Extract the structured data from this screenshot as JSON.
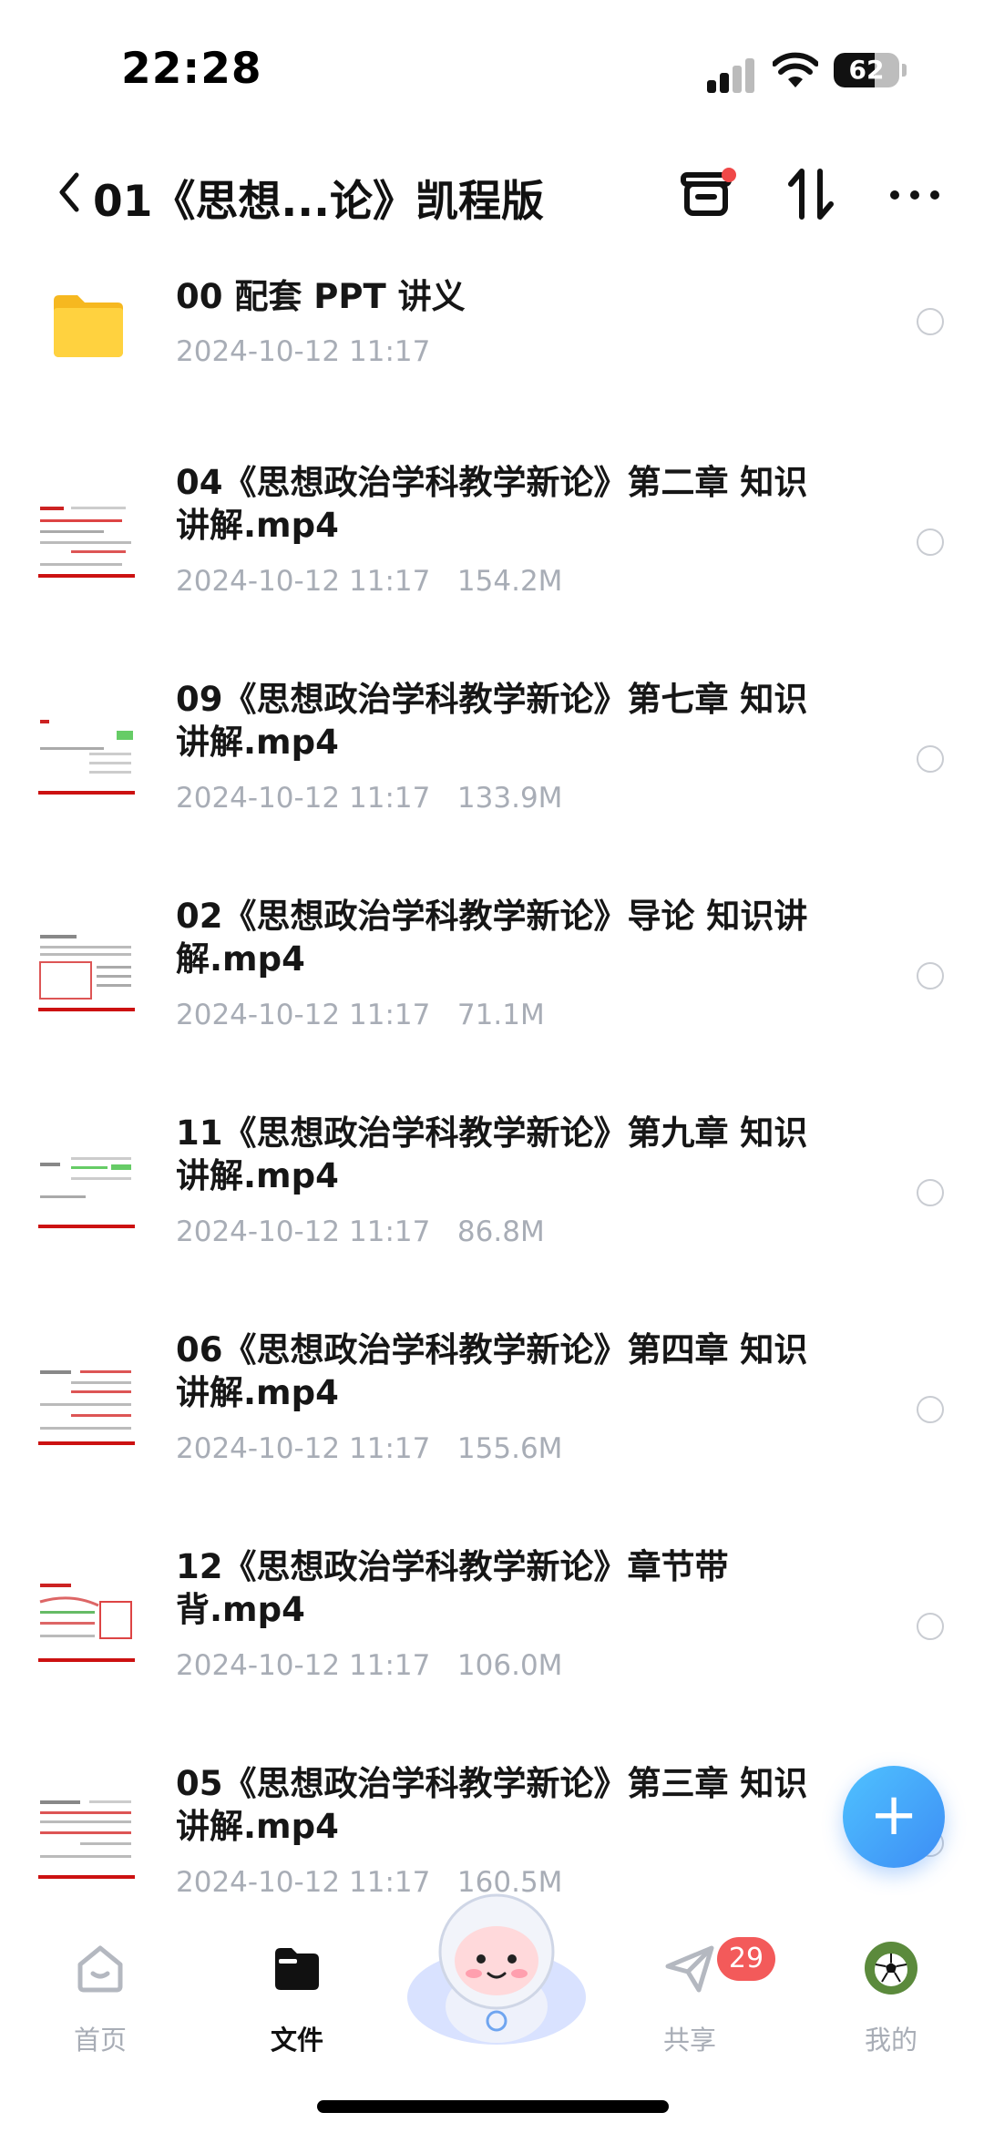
{
  "status_bar": {
    "time": "22:28",
    "battery": "62",
    "battery_level": 0.62
  },
  "nav": {
    "title": "01《思想...论》凯程版"
  },
  "files": [
    {
      "name": "00 配套 PPT 讲义",
      "date": "2024-10-12 11:17",
      "size": "",
      "type": "folder"
    },
    {
      "name": "04《思想政治学科教学新论》第二章 知识讲解.mp4",
      "date": "2024-10-12 11:17",
      "size": "154.2M",
      "type": "video"
    },
    {
      "name": "09《思想政治学科教学新论》第七章 知识讲解.mp4",
      "date": "2024-10-12 11:17",
      "size": "133.9M",
      "type": "video"
    },
    {
      "name": "02《思想政治学科教学新论》导论 知识讲解.mp4",
      "date": "2024-10-12 11:17",
      "size": "71.1M",
      "type": "video"
    },
    {
      "name": "11《思想政治学科教学新论》第九章 知识讲解.mp4",
      "date": "2024-10-12 11:17",
      "size": "86.8M",
      "type": "video"
    },
    {
      "name": "06《思想政治学科教学新论》第四章 知识讲解.mp4",
      "date": "2024-10-12 11:17",
      "size": "155.6M",
      "type": "video"
    },
    {
      "name": "12《思想政治学科教学新论》章节带背.mp4",
      "date": "2024-10-12 11:17",
      "size": "106.0M",
      "type": "video"
    },
    {
      "name": "05《思想政治学科教学新论》第三章 知识讲解.mp4",
      "date": "2024-10-12 11:17",
      "size": "160.5M",
      "type": "video"
    }
  ],
  "tabs": [
    {
      "label": "首页",
      "icon": "home-icon"
    },
    {
      "label": "文件",
      "icon": "folder-icon",
      "active": true
    },
    {
      "label": "共享",
      "icon": "paper-plane-icon",
      "badge": "29"
    },
    {
      "label": "我的",
      "icon": "avatar-icon"
    }
  ],
  "colors": {
    "accent": "#3d8df5",
    "badge": "#f35a5a",
    "meta_text": "#a8adb6"
  }
}
